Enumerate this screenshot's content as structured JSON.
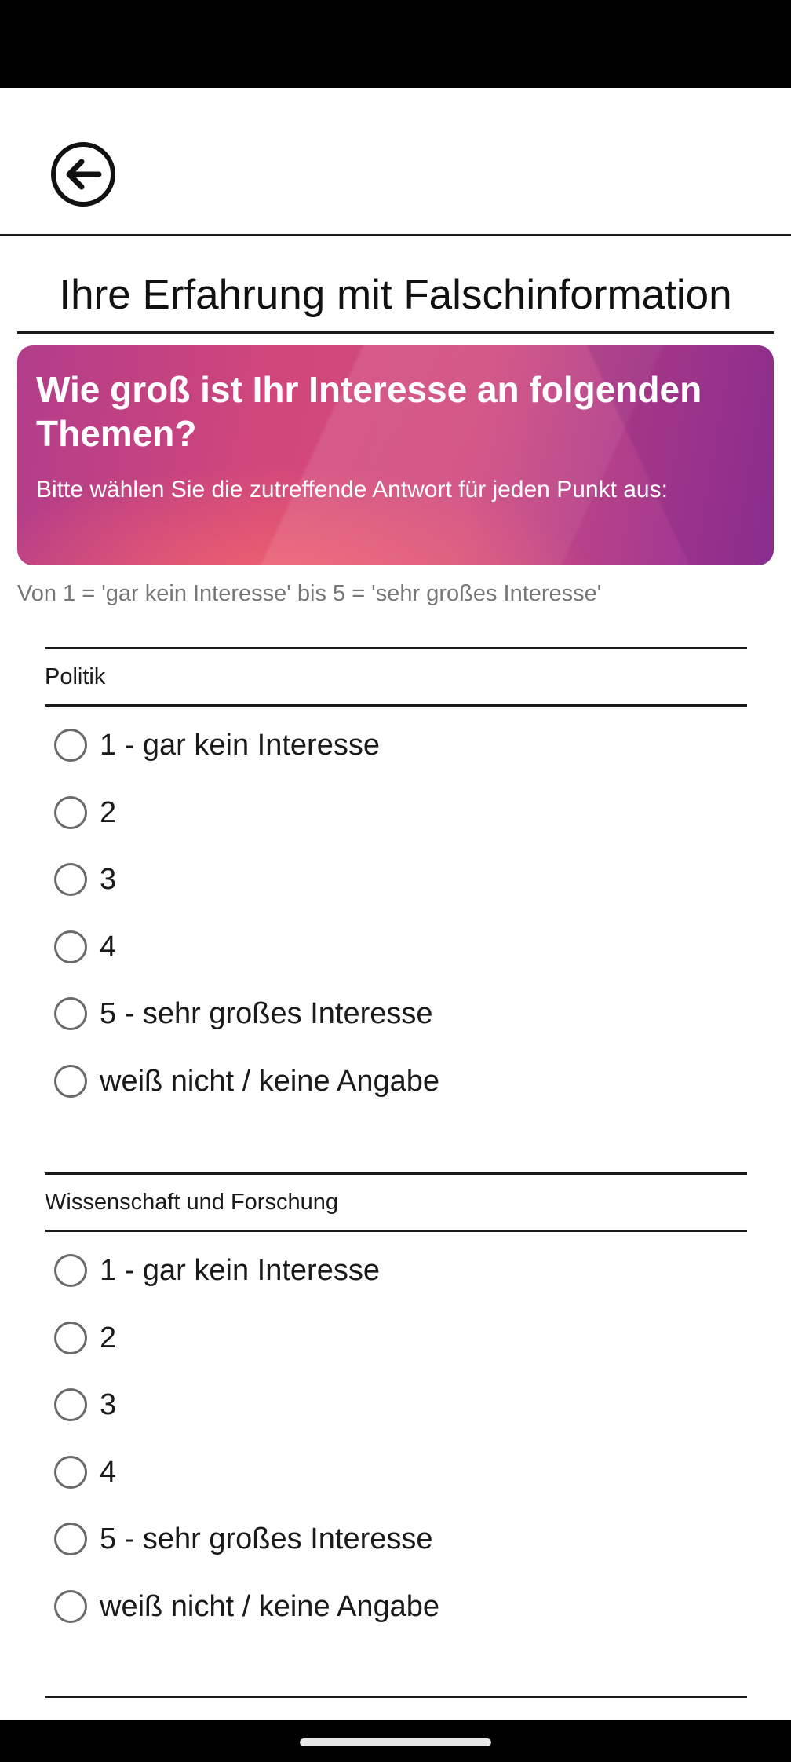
{
  "header": {
    "back_icon": "arrow-left-circle-icon"
  },
  "page": {
    "title": "Ihre Erfahrung mit Falschinformation"
  },
  "banner": {
    "question": "Wie groß ist Ihr Interesse an folgenden Themen?",
    "instruction": "Bitte wählen Sie die zutreffende Antwort für jeden Punkt aus:",
    "colors": {
      "start": "#b23d8a",
      "mid": "#d2477a",
      "end": "#8f3295"
    }
  },
  "scale_hint": "Von 1 = 'gar kein Interesse' bis 5 = 'sehr großes Interesse'",
  "groups": [
    {
      "title": "Politik",
      "options": [
        "1 - gar kein Interesse",
        "2",
        "3",
        "4",
        "5 - sehr großes Interesse",
        "weiß nicht / keine Angabe"
      ]
    },
    {
      "title": "Wissenschaft und Forschung",
      "options": [
        "1 - gar kein Interesse",
        "2",
        "3",
        "4",
        "5 - sehr großes Interesse",
        "weiß nicht / keine Angabe"
      ]
    }
  ]
}
